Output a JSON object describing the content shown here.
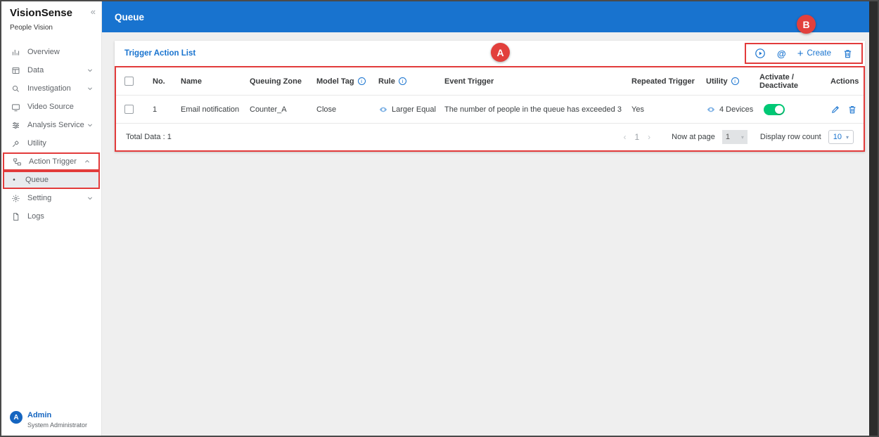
{
  "header": {
    "title": "Queue"
  },
  "sidebar": {
    "brand": "VisionSense",
    "subtitle": "People Vision",
    "items": [
      {
        "label": "Overview"
      },
      {
        "label": "Data"
      },
      {
        "label": "Investigation"
      },
      {
        "label": "Video Source"
      },
      {
        "label": "Analysis Service"
      },
      {
        "label": "Utility"
      },
      {
        "label": "Action Trigger"
      },
      {
        "label": "Queue"
      },
      {
        "label": "Setting"
      },
      {
        "label": "Logs"
      }
    ],
    "user": {
      "initial": "A",
      "name": "Admin",
      "role": "System Administrator"
    }
  },
  "panel": {
    "title": "Trigger Action List",
    "create_label": "Create"
  },
  "table": {
    "columns": [
      "No.",
      "Name",
      "Queuing Zone",
      "Model Tag",
      "Rule",
      "Event Trigger",
      "Repeated Trigger",
      "Utility",
      "Activate / Deactivate",
      "Actions"
    ],
    "rows": [
      {
        "no": "1",
        "name": "Email notification",
        "queuing_zone": "Counter_A",
        "model_tag": "Close",
        "rule": "Larger Equal",
        "event_trigger": "The number of people in the queue has exceeded 3",
        "repeated_trigger": "Yes",
        "utility": "4 Devices",
        "activated": true
      }
    ],
    "footer": {
      "total": "Total Data : 1",
      "page": "1",
      "now_at_page_label": "Now at page",
      "now_at_page_value": "1",
      "row_count_label": "Display row count",
      "row_count_value": "10"
    }
  },
  "annotations": {
    "a": "A",
    "b": "B"
  },
  "icons": {
    "collapse": "«",
    "info": "i",
    "plus": "+",
    "at": "@",
    "prev": "‹",
    "next": "›",
    "bullet": "•",
    "caret": "▾"
  },
  "colors": {
    "accent": "#1873cf",
    "toggle_on": "#00c875",
    "annotation": "#e23b3b"
  }
}
